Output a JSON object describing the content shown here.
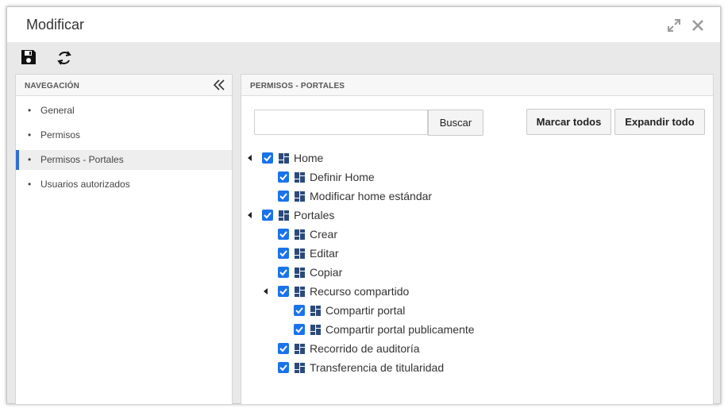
{
  "window": {
    "title": "Modificar"
  },
  "icons": {
    "maximize": "expand-arrows-icon",
    "close": "close-x-icon",
    "save": "floppy-disk-icon",
    "refresh": "refresh-arrows-icon",
    "collapse": "double-chevron-left-icon",
    "node": "portal-grid-icon"
  },
  "colors": {
    "accent": "#2f6fd0",
    "checkbox": "#1a73e8",
    "node_icon": "#2b4a7a"
  },
  "navigation": {
    "header": "NAVEGACIÓN",
    "items": [
      {
        "label": "General",
        "active": false
      },
      {
        "label": "Permisos",
        "active": false
      },
      {
        "label": "Permisos - Portales",
        "active": true
      },
      {
        "label": "Usuarios autorizados",
        "active": false
      }
    ]
  },
  "main": {
    "header": "PERMISOS - PORTALES",
    "search": {
      "value": "",
      "placeholder": "",
      "button": "Buscar"
    },
    "mark_all": "Marcar todos",
    "expand_all": "Expandir todo",
    "tree": [
      {
        "label": "Home",
        "level": 0,
        "expanded": true,
        "checked": true
      },
      {
        "label": "Definir Home",
        "level": 1,
        "checked": true
      },
      {
        "label": "Modificar home estándar",
        "level": 1,
        "checked": true
      },
      {
        "label": "Portales",
        "level": 0,
        "expanded": true,
        "checked": true
      },
      {
        "label": "Crear",
        "level": 1,
        "checked": true
      },
      {
        "label": "Editar",
        "level": 1,
        "checked": true
      },
      {
        "label": "Copiar",
        "level": 1,
        "checked": true
      },
      {
        "label": "Recurso compartido",
        "level": 1,
        "expanded": true,
        "checked": true
      },
      {
        "label": "Compartir portal",
        "level": 2,
        "checked": true
      },
      {
        "label": "Compartir portal publicamente",
        "level": 2,
        "checked": true
      },
      {
        "label": "Recorrido de auditoría",
        "level": 1,
        "checked": true
      },
      {
        "label": "Transferencia de titularidad",
        "level": 1,
        "checked": true
      }
    ]
  }
}
